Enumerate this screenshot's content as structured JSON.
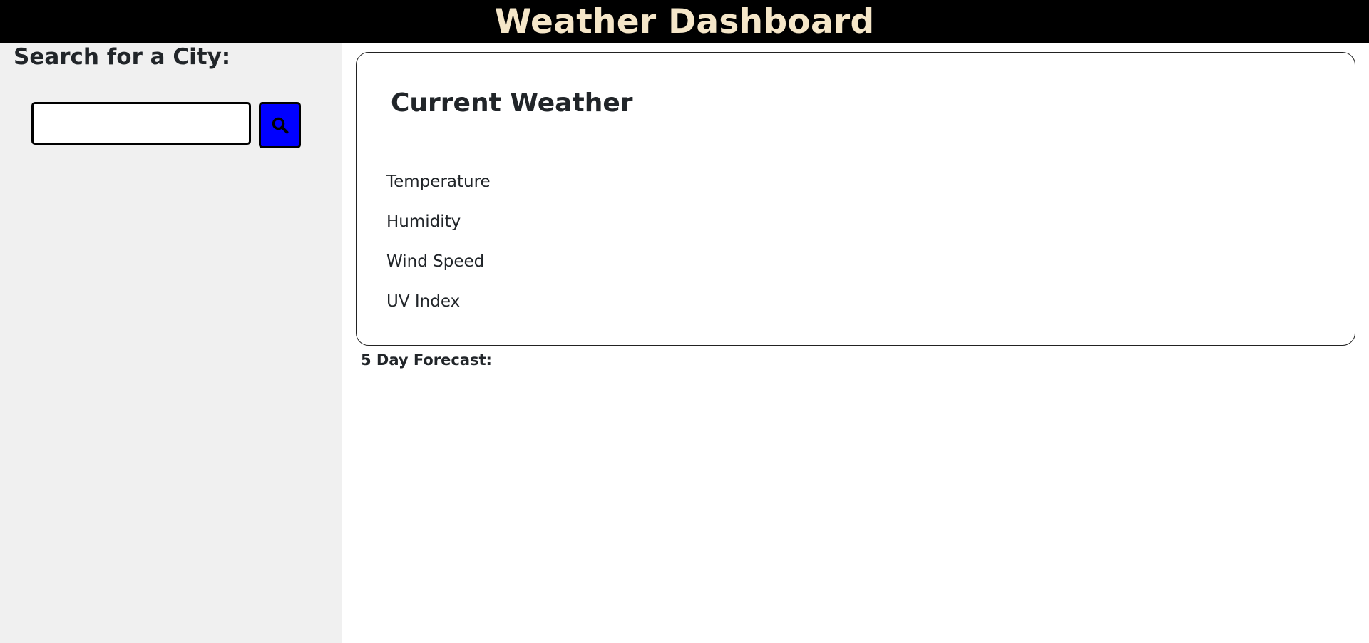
{
  "header": {
    "title": "Weather Dashboard"
  },
  "sidebar": {
    "title": "Search for a City:",
    "search_input": {
      "value": "",
      "placeholder": ""
    },
    "search_button_icon": "search-icon"
  },
  "current_weather": {
    "title": "Current Weather",
    "stats": {
      "temperature": "Temperature",
      "humidity": "Humidity",
      "wind_speed": "Wind Speed",
      "uv_index": "UV Index"
    }
  },
  "forecast": {
    "title": "5 Day Forecast:"
  },
  "colors": {
    "header_bg": "#000000",
    "header_text": "#f5e6c8",
    "sidebar_bg": "#f0f0f0",
    "search_button_bg": "#0000ff"
  }
}
